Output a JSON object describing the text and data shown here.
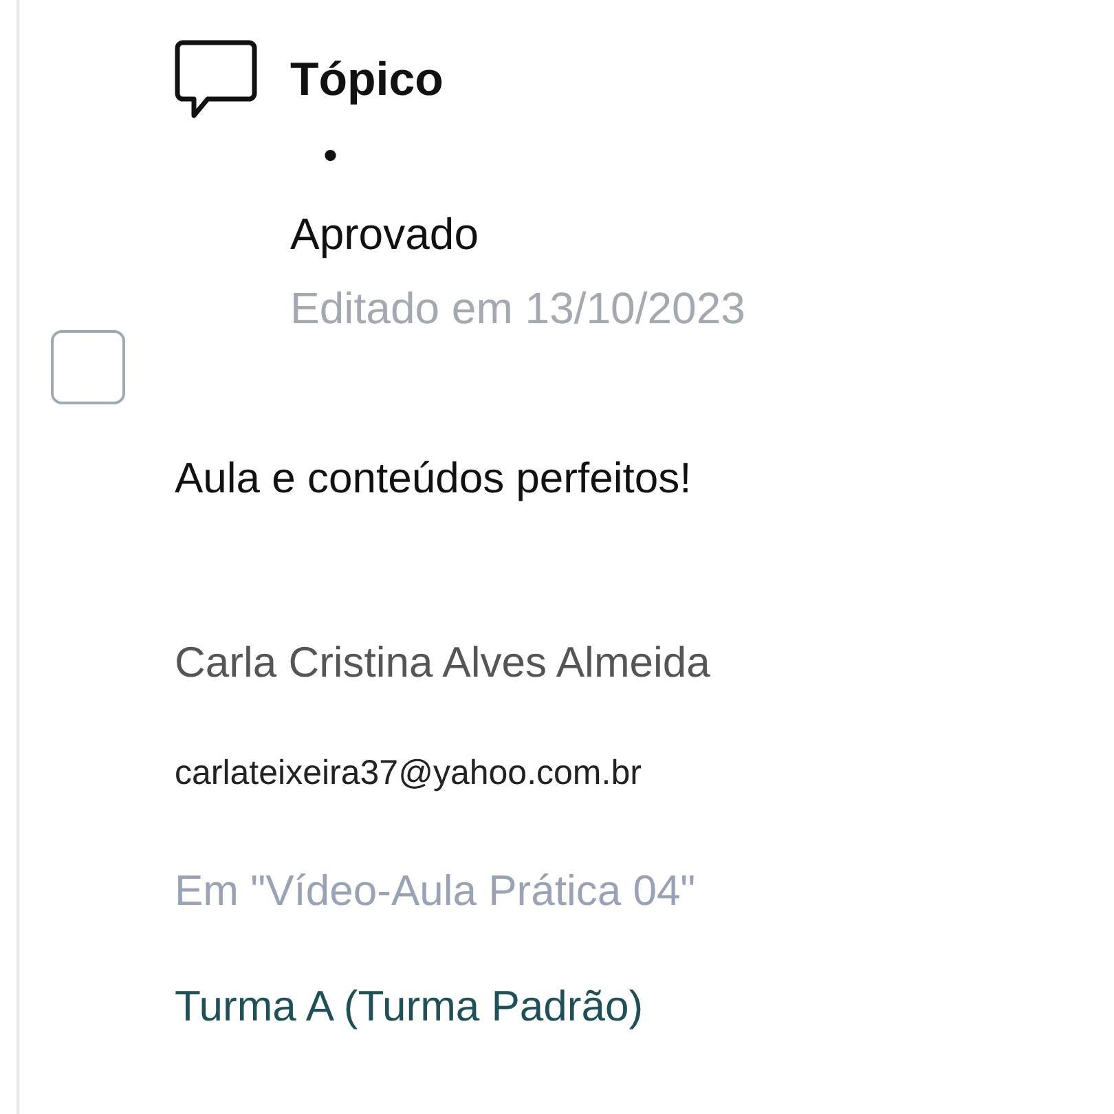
{
  "checkbox": {
    "checked": false
  },
  "topic": {
    "title": "Tópico",
    "separator": "•",
    "status": "Aprovado",
    "edited": "Editado em 13/10/2023"
  },
  "comment": "Aula e conteúdos perfeitos!",
  "author": {
    "name": "Carla Cristina Alves Almeida",
    "email": "carlateixeira37@yahoo.com.br"
  },
  "context": "Em \"Vídeo-Aula Prática 04\"",
  "group": "Turma A (Turma Padrão)"
}
